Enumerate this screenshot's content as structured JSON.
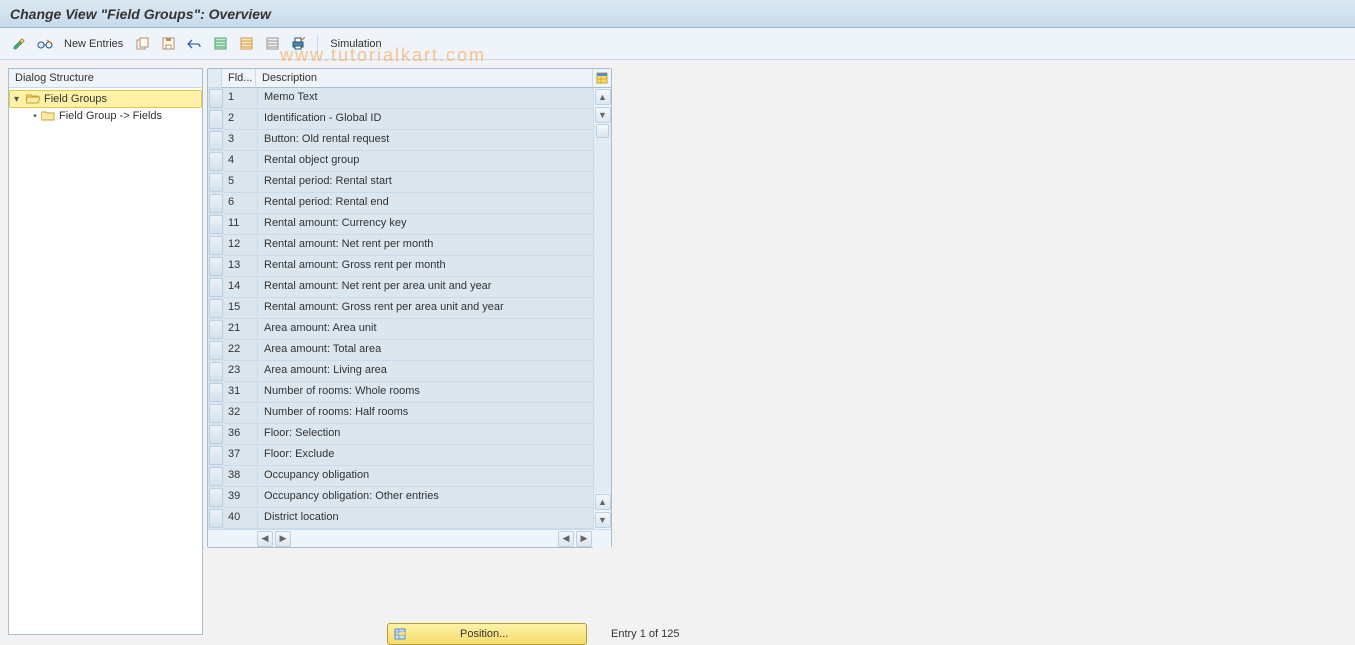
{
  "title": "Change View \"Field Groups\": Overview",
  "toolbar": {
    "new_entries": "New Entries",
    "simulation": "Simulation"
  },
  "watermark": "www.tutorialkart.com",
  "tree": {
    "header": "Dialog Structure",
    "root_label": "Field Groups",
    "child_label": "Field Group -> Fields"
  },
  "table": {
    "header_fld": "Fld...",
    "header_desc": "Description",
    "rows": [
      {
        "fld": "1",
        "desc": "Memo Text"
      },
      {
        "fld": "2",
        "desc": "Identification - Global ID"
      },
      {
        "fld": "3",
        "desc": "Button: Old rental request"
      },
      {
        "fld": "4",
        "desc": "Rental object group"
      },
      {
        "fld": "5",
        "desc": "Rental period: Rental start"
      },
      {
        "fld": "6",
        "desc": "Rental period: Rental end"
      },
      {
        "fld": "11",
        "desc": "Rental amount: Currency key"
      },
      {
        "fld": "12",
        "desc": "Rental amount: Net rent per month"
      },
      {
        "fld": "13",
        "desc": "Rental amount: Gross rent per month"
      },
      {
        "fld": "14",
        "desc": "Rental amount: Net rent per area unit and year"
      },
      {
        "fld": "15",
        "desc": "Rental amount: Gross rent per area unit and year"
      },
      {
        "fld": "21",
        "desc": "Area amount: Area unit"
      },
      {
        "fld": "22",
        "desc": "Area amount: Total area"
      },
      {
        "fld": "23",
        "desc": "Area amount: Living area"
      },
      {
        "fld": "31",
        "desc": "Number of rooms: Whole rooms"
      },
      {
        "fld": "32",
        "desc": "Number of rooms: Half rooms"
      },
      {
        "fld": "36",
        "desc": "Floor: Selection"
      },
      {
        "fld": "37",
        "desc": "Floor: Exclude"
      },
      {
        "fld": "38",
        "desc": "Occupancy obligation"
      },
      {
        "fld": "39",
        "desc": "Occupancy obligation: Other entries"
      },
      {
        "fld": "40",
        "desc": "District location"
      }
    ]
  },
  "footer": {
    "position_label": "Position...",
    "entry_label": "Entry 1 of 125"
  }
}
